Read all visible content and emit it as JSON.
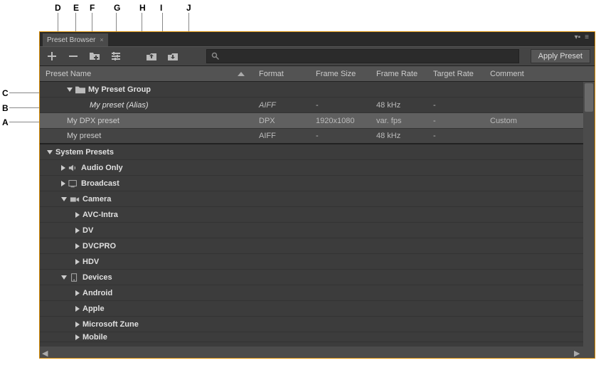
{
  "callouts": {
    "A": "A",
    "B": "B",
    "C": "C",
    "D": "D",
    "E": "E",
    "F": "F",
    "G": "G",
    "H": "H",
    "I": "I",
    "J": "J"
  },
  "tab": {
    "title": "Preset Browser"
  },
  "toolbar": {
    "apply_label": "Apply Preset"
  },
  "search": {
    "placeholder": ""
  },
  "columns": {
    "name": "Preset Name",
    "format": "Format",
    "frame_size": "Frame Size",
    "frame_rate": "Frame Rate",
    "target_rate": "Target Rate",
    "comment": "Comment"
  },
  "rows": {
    "group": "My Preset Group",
    "alias": {
      "name": "My preset (Alias)",
      "format": "AIFF",
      "fsize": "-",
      "frate": "48 kHz",
      "trate": "-"
    },
    "dpx": {
      "name": "My DPX preset",
      "format": "DPX",
      "fsize": "1920x1080",
      "frate": "var. fps",
      "trate": "-",
      "comment": "Custom"
    },
    "aiff": {
      "name": "My preset",
      "format": "AIFF",
      "fsize": "-",
      "frate": "48 kHz",
      "trate": "-"
    },
    "system": "System Presets",
    "audio_only": "Audio Only",
    "broadcast": "Broadcast",
    "camera": "Camera",
    "avc": "AVC-Intra",
    "dv": "DV",
    "dvcpro": "DVCPRO",
    "hdv": "HDV",
    "devices": "Devices",
    "android": "Android",
    "apple": "Apple",
    "zune": "Microsoft Zune",
    "mobile": "Mobile"
  }
}
